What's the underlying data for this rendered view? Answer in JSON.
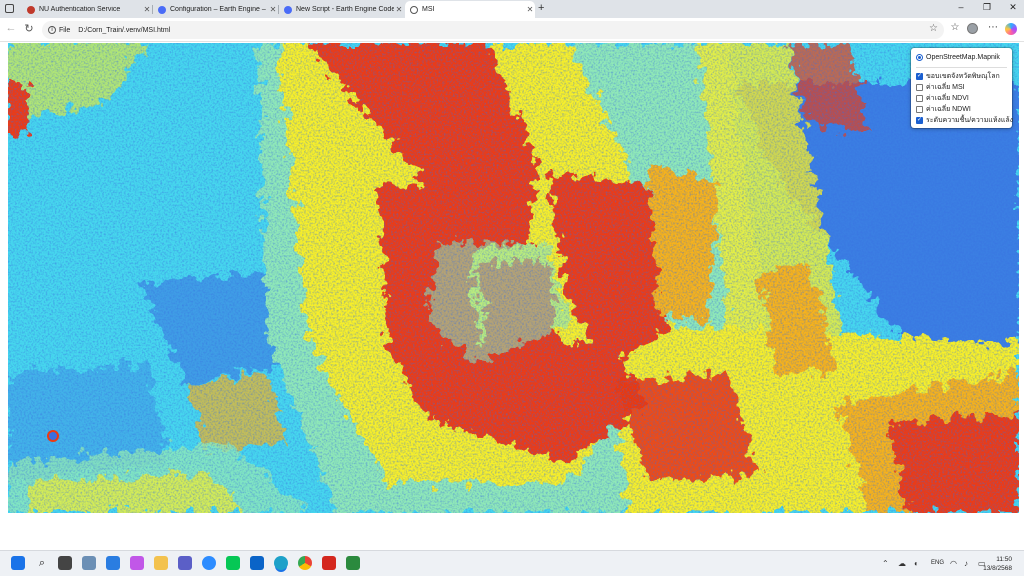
{
  "browser": {
    "tabs": [
      {
        "title": "NU Authentication Service",
        "active": false,
        "favicon_color": "#c0392b"
      },
      {
        "title": "Configuration – Earth Engine – M",
        "active": false,
        "favicon_color": "#4a6cf7"
      },
      {
        "title": "New Script - Earth Engine Code E",
        "active": false,
        "favicon_color": "#4a6cf7"
      },
      {
        "title": "MSI",
        "active": true,
        "favicon_color": "#555555"
      }
    ],
    "new_tab_symbol": "+",
    "address": {
      "scheme_label": "File",
      "url": "D:/Corn_Train/.venv/MSI.html"
    },
    "window_controls": {
      "minimize": "–",
      "maximize": "❐",
      "close": "✕"
    }
  },
  "layer_control": {
    "base_layers": [
      {
        "label": "OpenStreetMap.Mapnik",
        "selected": true
      }
    ],
    "overlays": [
      {
        "label": "ขอบเขตจังหวัดพิษณุโลก",
        "checked": true
      },
      {
        "label": "ค่าเฉลี่ย MSI",
        "checked": false
      },
      {
        "label": "ค่าเฉลี่ย NDVI",
        "checked": false
      },
      {
        "label": "ค่าเฉลี่ย NDWI",
        "checked": false
      },
      {
        "label": "ระดับความชื้น/ความแห้งแล้ง",
        "checked": true
      }
    ]
  },
  "map": {
    "palette": [
      "#3a6fe0",
      "#46d6ee",
      "#8fe8b8",
      "#f7ef2a",
      "#f6b21c",
      "#ec3a12"
    ]
  },
  "taskbar": {
    "language": "ENG",
    "time": "11:50",
    "date": "13/8/2568"
  }
}
